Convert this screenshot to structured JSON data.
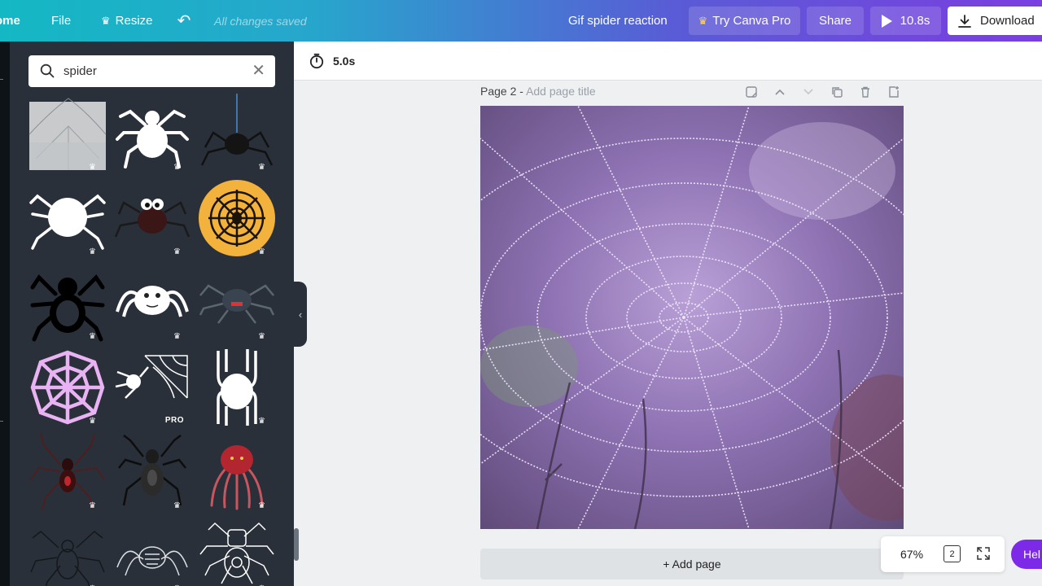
{
  "topbar": {
    "home_label": "ome",
    "file_label": "File",
    "resize_label": "Resize",
    "saved_status": "All changes saved",
    "design_title": "Gif spider reaction",
    "try_pro_label": "Try Canva Pro",
    "share_label": "Share",
    "play_duration": "10.8s",
    "download_label": "Download"
  },
  "search": {
    "query": "spider"
  },
  "results": {
    "pro_badge": "PRO",
    "items": [
      {
        "name": "spider-web-sketch",
        "badge": "crown"
      },
      {
        "name": "white-spider",
        "badge": "crown"
      },
      {
        "name": "hanging-black-spider",
        "badge": "crown"
      },
      {
        "name": "white-spider-round",
        "badge": "crown"
      },
      {
        "name": "cartoon-spider-eyes",
        "badge": "crown"
      },
      {
        "name": "spiderweb-orange-circle",
        "badge": "crown"
      },
      {
        "name": "black-outline-spider",
        "badge": "crown"
      },
      {
        "name": "fluffy-white-spider",
        "badge": "crown"
      },
      {
        "name": "dark-scary-spider",
        "badge": "crown"
      },
      {
        "name": "pink-spiderweb",
        "badge": "crown"
      },
      {
        "name": "spider-with-web",
        "badge": "pro"
      },
      {
        "name": "white-spider-legs-up",
        "badge": "crown"
      },
      {
        "name": "red-black-spider",
        "badge": "crown"
      },
      {
        "name": "grey-spider",
        "badge": "crown"
      },
      {
        "name": "red-octopus-spider",
        "badge": "crown"
      },
      {
        "name": "line-spider",
        "badge": "crown"
      },
      {
        "name": "sketch-spider",
        "badge": "crown"
      },
      {
        "name": "outline-robot-spider",
        "badge": "crown"
      }
    ]
  },
  "editor": {
    "duration": "5.0s",
    "page_label": "Page 2 -",
    "page_title_placeholder": "Add page title",
    "add_page_label": "+ Add page",
    "zoom": "67%",
    "page_count": "2",
    "help_label": "Hel"
  },
  "colors": {
    "panel_bg": "#293039",
    "help_purple": "#7d2ae8",
    "crown_gold": "#ffd84a"
  }
}
